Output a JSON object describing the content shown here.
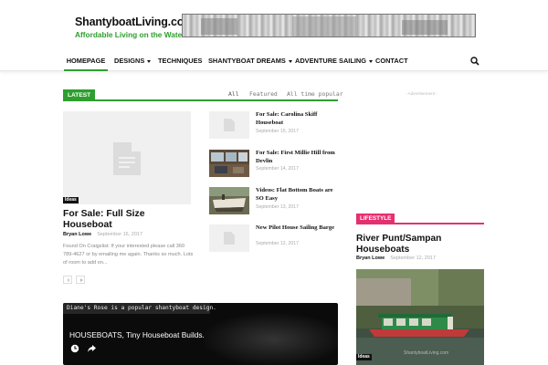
{
  "brand": {
    "title_part1": "Shantyboat",
    "title_part2": "Living",
    "title_part3": ".com",
    "tagline": "Affordable Living on the Water",
    "accent_color": "#2e9e2e"
  },
  "nav": {
    "items": [
      {
        "label": "HOMEPAGE",
        "active": true
      },
      {
        "label": "DESIGNS",
        "dropdown": true
      },
      {
        "label": "TECHNIQUES"
      },
      {
        "label": "SHANTYBOAT DREAMS",
        "dropdown": true
      },
      {
        "label": "ADVENTURE SAILING",
        "dropdown": true
      },
      {
        "label": "CONTACT"
      }
    ],
    "search_icon": "search-icon"
  },
  "latest": {
    "label": "LATEST",
    "filters": [
      "All",
      "Featured",
      "All time popular"
    ],
    "featured": {
      "category": "Ideas",
      "title": "For Sale: Full Size Houseboat",
      "author": "Bryan Lowe",
      "date": "September 16, 2017",
      "excerpt": "Found On Craigslist:   If your interested please call 360 789-4627 or by emailing me again. Thanks so much. Lots of room to add on..."
    },
    "list": [
      {
        "title": "For Sale: Carolina Skiff Houseboat",
        "date": "September 15, 2017",
        "thumb": "placeholder"
      },
      {
        "title": "For Sale: First Millie Hill from Devlin",
        "date": "September 14, 2017",
        "thumb": "cabin-interior-photo"
      },
      {
        "title": "Videos: Flat Bottom Boats are SO Easy",
        "date": "September 13, 2017",
        "thumb": "boat-build-photo"
      },
      {
        "title": "New Pilot House Sailing Barge",
        "date": "September 12, 2017",
        "thumb": "placeholder"
      }
    ],
    "pager_prev": "prev-page",
    "pager_next": "next-page"
  },
  "video": {
    "caption": "Diane's Rose is a popular shantyboat design.",
    "title": "HOUSEBOATS, Tiny Houseboat Builds.",
    "icons": [
      "clock-icon",
      "share-icon"
    ]
  },
  "sidebar": {
    "advertisement": "- Advertisement -",
    "section_label": "LIFESTYLE",
    "section_color": "#e5306f",
    "post": {
      "title": "River Punt/Sampan Houseboats",
      "author": "Bryan Lowe",
      "date": "September 12, 2017",
      "category": "Ideas",
      "watermark": "ShantyboatLiving.com"
    }
  }
}
